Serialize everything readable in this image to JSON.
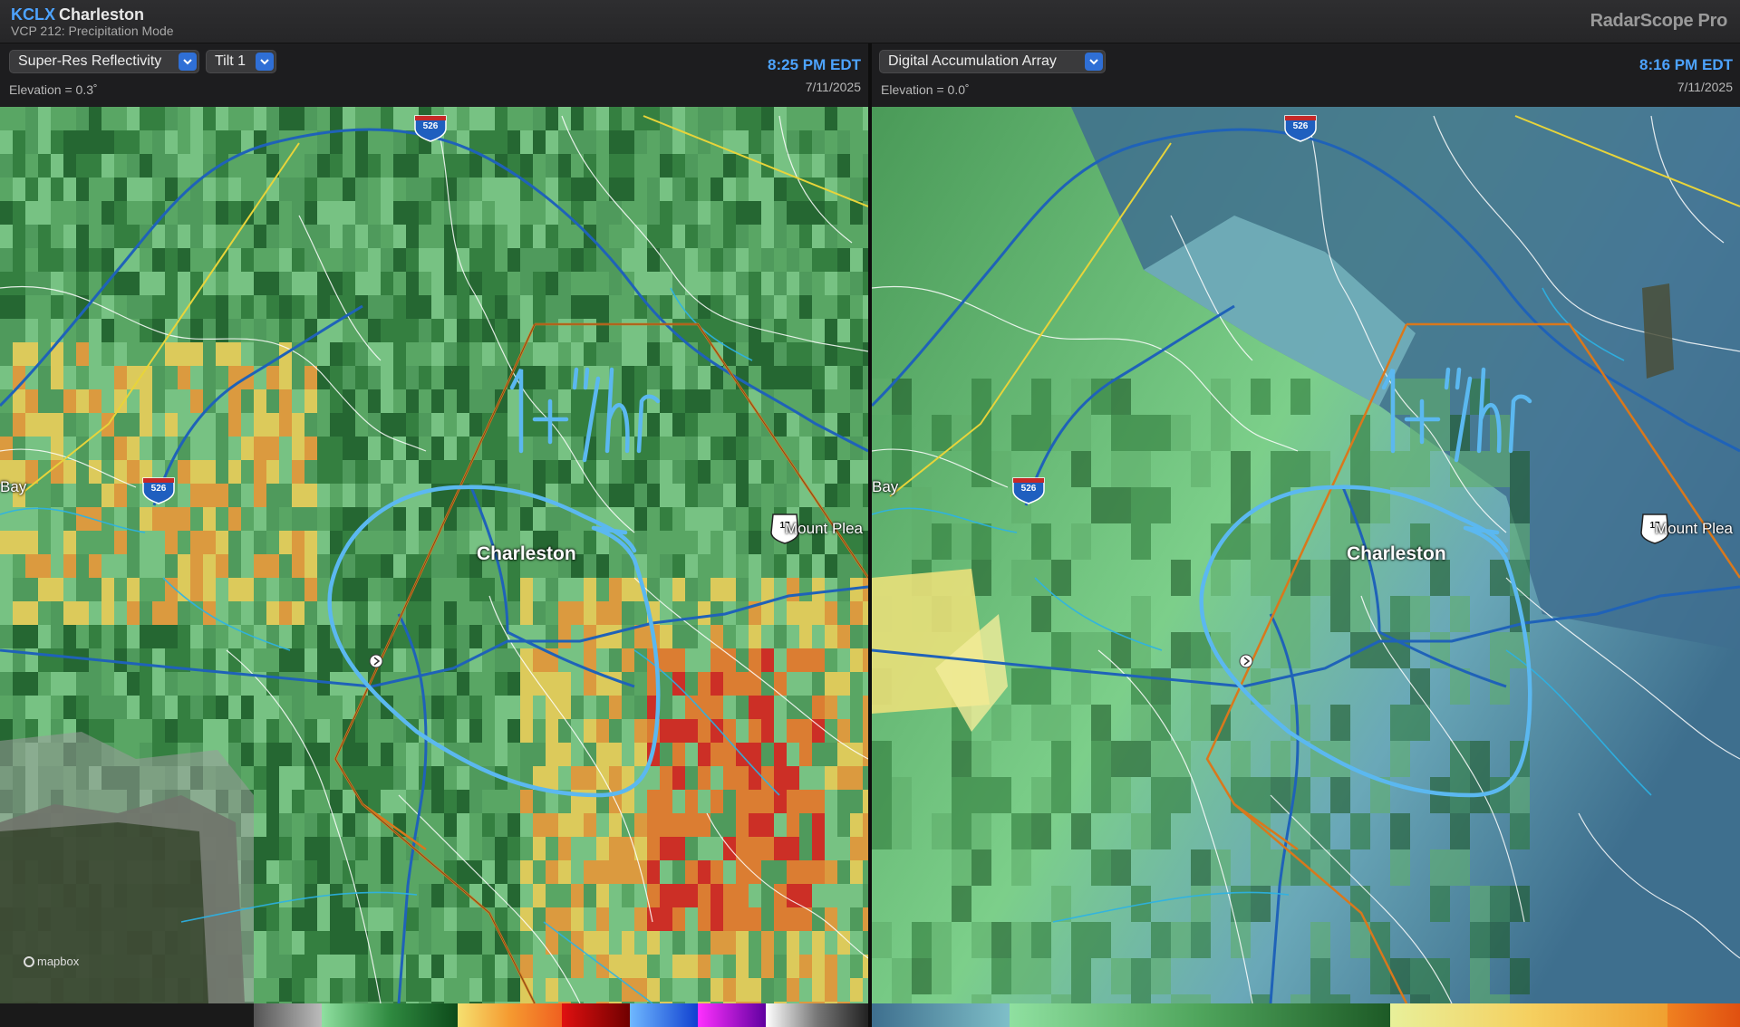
{
  "titlebar": {
    "station_code": "KCLX",
    "station_name": "Charleston",
    "vcp": "VCP 212: Precipitation Mode",
    "app_name": "RadarScope Pro"
  },
  "left_panel": {
    "product": "Super-Res Reflectivity",
    "tilt": "Tilt 1",
    "elevation": "Elevation = 0.3˚",
    "time": "8:25 PM EDT",
    "date": "7/11/2025"
  },
  "right_panel": {
    "product": "Digital Accumulation Array",
    "elevation": "Elevation = 0.0˚",
    "time": "8:16 PM EDT",
    "date": "7/11/2025"
  },
  "map": {
    "city_label": "Charleston",
    "mount_pleasant_label": "Mount Plea",
    "bay_label": "Bay",
    "annotation": "1+\"/hr",
    "shields": {
      "interstate_526": "526",
      "us_17": "17"
    },
    "attribution": "mapbox"
  },
  "colors": {
    "annotation": "#5bb8f0",
    "county_line": "#d9781c",
    "highway": "#2f7fd0",
    "accent": "#4da3ff"
  }
}
